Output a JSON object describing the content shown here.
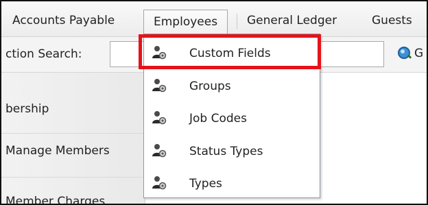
{
  "menubar": {
    "items": [
      "Accounts Payable",
      "Employees",
      "General Ledger",
      "Guests"
    ]
  },
  "search": {
    "label": "ction Search:",
    "value": "",
    "placeholder": "",
    "go_label": "G"
  },
  "leftnav": {
    "items": [
      "bership",
      "Manage Members",
      "Member Charges"
    ]
  },
  "dropdown": {
    "items": [
      {
        "label": "Custom Fields",
        "icon": "user-gear-icon",
        "highlighted": true
      },
      {
        "label": "Groups",
        "icon": "user-gear-icon"
      },
      {
        "label": "Job Codes",
        "icon": "user-gear-icon"
      },
      {
        "label": "Status Types",
        "icon": "user-gear-icon"
      },
      {
        "label": "Types",
        "icon": "user-gear-icon"
      }
    ],
    "highlight_color": "#e4131a"
  },
  "colors": {
    "menubar_bg": "#f1f1f1",
    "dropdown_border": "#8d99a6",
    "highlight": "#e4131a"
  }
}
